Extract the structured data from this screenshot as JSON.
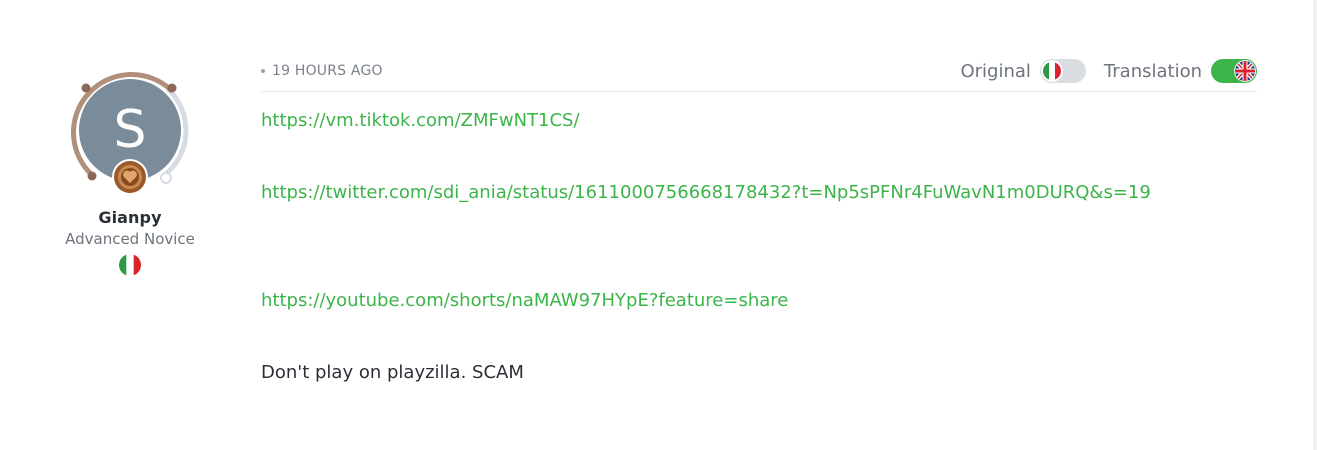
{
  "author": {
    "avatar_letter": "S",
    "avatar_color": "#7a8c99",
    "username": "Gianpy",
    "rank": "Advanced Novice",
    "country_flag_icon": "italy-flag-icon"
  },
  "post": {
    "timestamp": "19 HOURS AGO",
    "toggles": {
      "original_label": "Original",
      "original_state": "off",
      "translation_label": "Translation",
      "translation_state": "on"
    },
    "links": [
      "https://vm.tiktok.com/ZMFwNT1CS/",
      "https://twitter.com/sdi_ania/status/1611000756668178432?t=Np5sPFNr4FuWavN1m0DURQ&s=19",
      "https://youtube.com/shorts/naMAW97HYpE?feature=share"
    ],
    "message": "Don't play on playzilla. SCAM"
  },
  "colors": {
    "accent_green": "#3cb44a",
    "text": "#2b2f36",
    "muted": "#6d747d"
  }
}
